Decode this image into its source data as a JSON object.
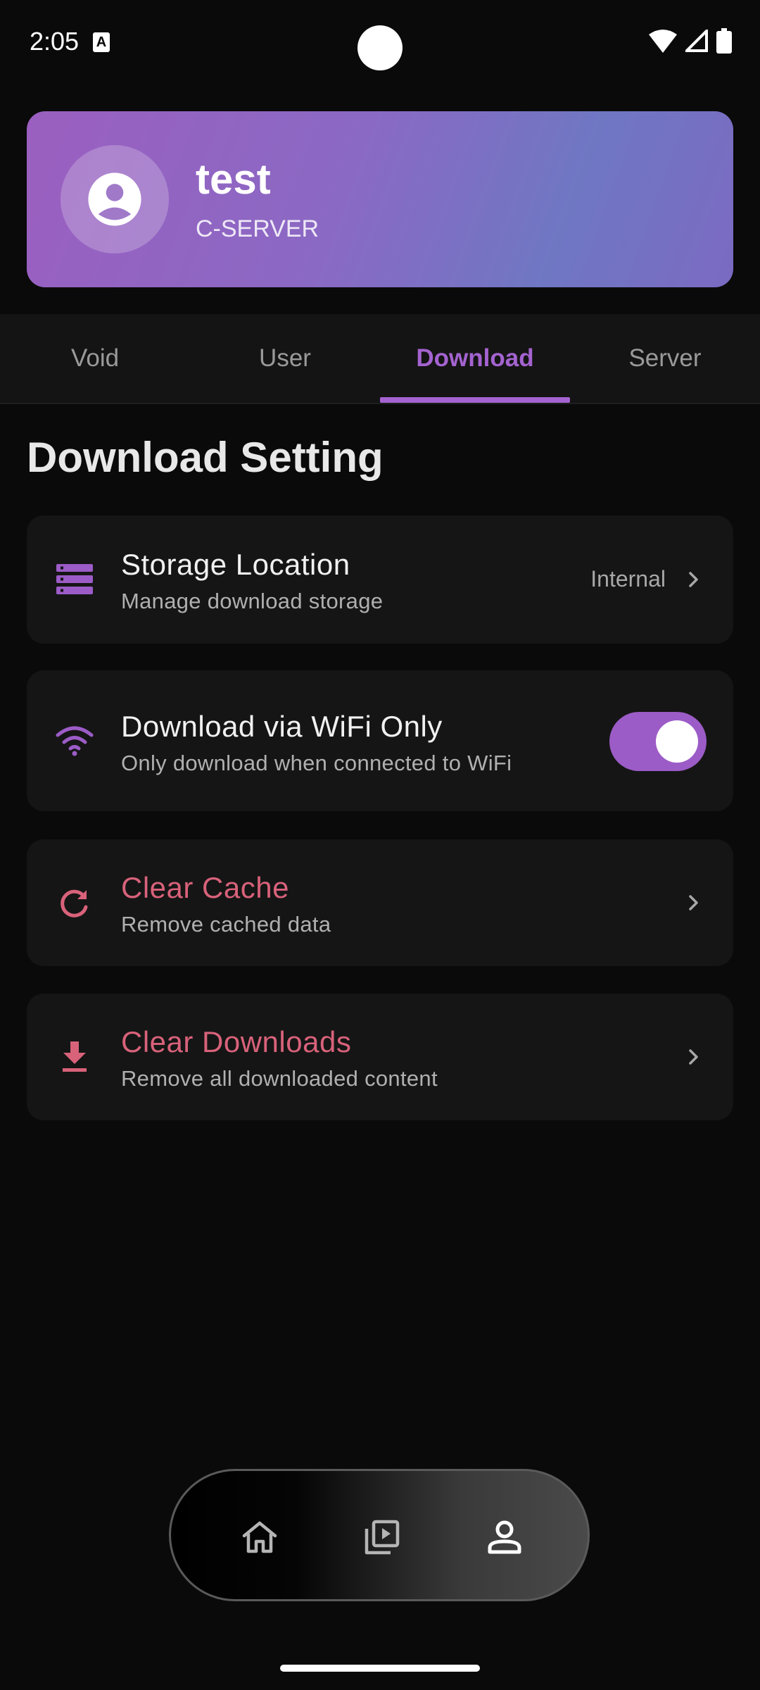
{
  "status_bar": {
    "time": "2:05",
    "notification_glyph": "A"
  },
  "profile": {
    "name": "test",
    "server": "C-SERVER"
  },
  "tabs": [
    {
      "label": "Void",
      "active": false
    },
    {
      "label": "User",
      "active": false
    },
    {
      "label": "Download",
      "active": true
    },
    {
      "label": "Server",
      "active": false
    }
  ],
  "section_title": "Download Setting",
  "settings": {
    "storage": {
      "title": "Storage Location",
      "subtitle": "Manage download storage",
      "value": "Internal",
      "icon": "storage-icon"
    },
    "wifi": {
      "title": "Download via WiFi Only",
      "subtitle": "Only download when connected to WiFi",
      "enabled": true,
      "icon": "wifi-icon"
    },
    "clear_cache": {
      "title": "Clear Cache",
      "subtitle": "Remove cached data",
      "icon": "refresh-icon"
    },
    "clear_downloads": {
      "title": "Clear Downloads",
      "subtitle": "Remove all downloaded content",
      "icon": "download-icon"
    }
  },
  "bottom_nav": [
    "home-icon",
    "media-library-icon",
    "profile-icon"
  ],
  "colors": {
    "accent": "#a463d0",
    "danger": "#d8627a",
    "background": "#0a0a0a",
    "card": "#151515"
  }
}
